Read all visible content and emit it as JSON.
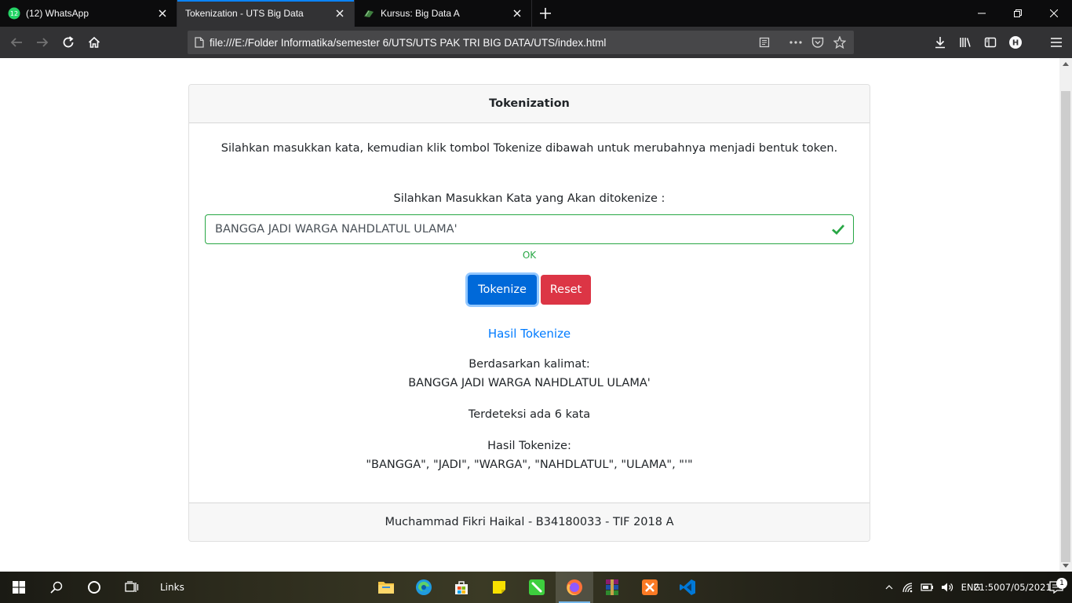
{
  "browser": {
    "tabs": [
      {
        "title": "(12) WhatsApp",
        "favicon": "whatsapp-icon",
        "badge": "12",
        "active": false
      },
      {
        "title": "Tokenization - UTS Big Data",
        "favicon": "none",
        "active": true
      },
      {
        "title": "Kursus: Big Data A",
        "favicon": "moodle-icon",
        "active": false
      }
    ],
    "url": "file:///E:/Folder Informatika/semester 6/UTS/UTS PAK TRI BIG DATA/UTS/index.html"
  },
  "page": {
    "header": "Tokenization",
    "intro": "Silahkan masukkan kata, kemudian klik tombol Tokenize dibawah untuk merubahnya menjadi bentuk token.",
    "field_label": "Silahkan Masukkan Kata yang Akan ditokenize :",
    "input_value": "BANGGA JADI WARGA NAHDLATUL ULAMA'",
    "valid_feedback": "OK",
    "tokenize_button": "Tokenize",
    "reset_button": "Reset",
    "result_title": "Hasil Tokenize",
    "based_on_label": "Berdasarkan kalimat:",
    "based_on_sentence": "BANGGA JADI WARGA NAHDLATUL ULAMA'",
    "detected": "Terdeteksi ada 6 kata",
    "result_label": "Hasil Tokenize:",
    "result_tokens": "\"BANGGA\", \"JADI\", \"WARGA\", \"NAHDLATUL\", \"ULAMA\", \"'\"",
    "footer": "Muchammad Fikri Haikal - B34180033 - TIF 2018 A"
  },
  "taskbar": {
    "links_label": "Links",
    "language": "ENG",
    "time": "21:50",
    "date": "07/05/2021",
    "notification_count": "1"
  },
  "colors": {
    "primary": "#007bff",
    "danger": "#dc3545",
    "success": "#28a745",
    "tab_accent": "#0a84ff"
  }
}
